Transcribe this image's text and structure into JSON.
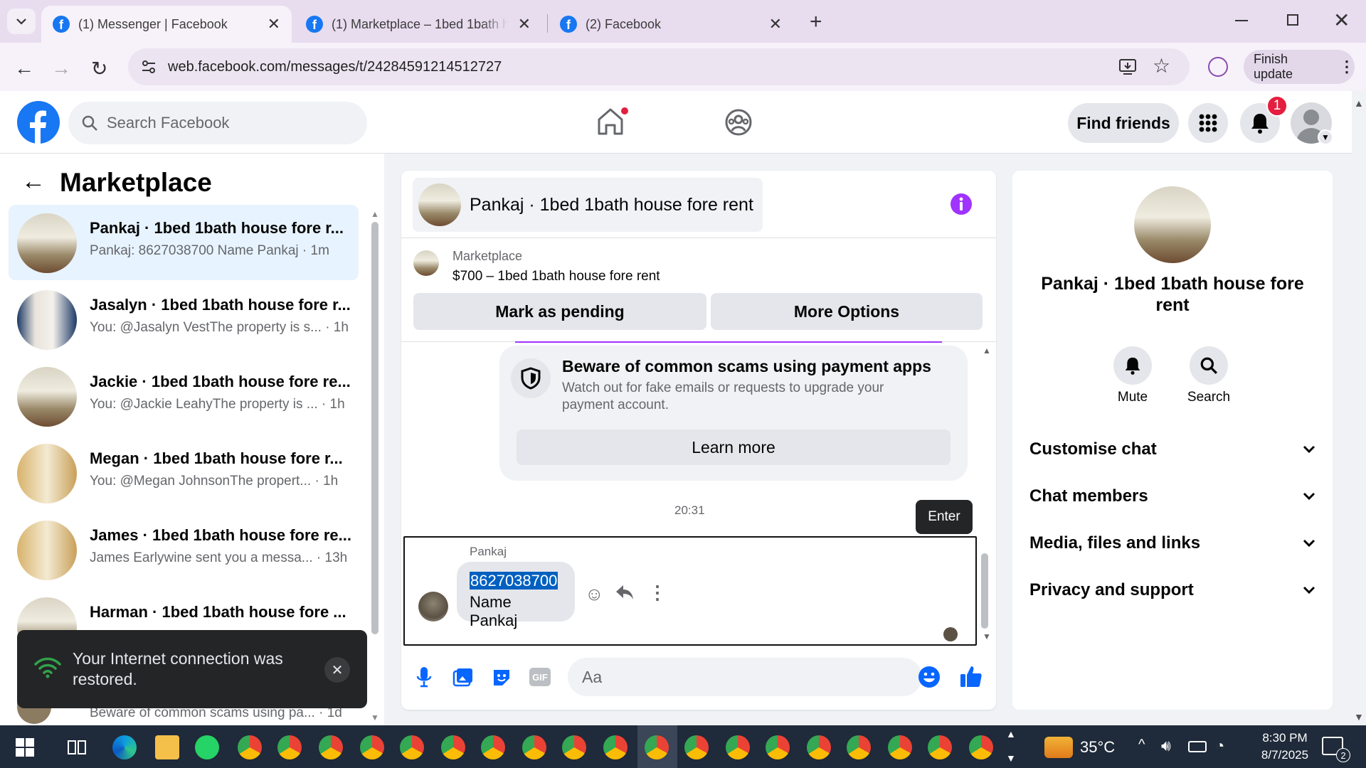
{
  "browser": {
    "tabs": [
      {
        "title": "(1) Messenger | Facebook",
        "active": true
      },
      {
        "title": "(1) Marketplace – 1bed 1bath h",
        "active": false
      },
      {
        "title": "(2) Facebook",
        "active": false
      }
    ],
    "url": "web.facebook.com/messages/t/24284591214512727",
    "finish_update": "Finish update"
  },
  "fb_header": {
    "search_placeholder": "Search Facebook",
    "find_friends": "Find friends",
    "notification_count": "1"
  },
  "left_panel": {
    "title": "Marketplace",
    "conversations": [
      {
        "name": "Pankaj · 1bed 1bath house fore r...",
        "preview": "Pankaj: 8627038700 Name Pankaj · 1m",
        "selected": true
      },
      {
        "name": "Jasalyn · 1bed 1bath house fore r...",
        "preview": "You: @Jasalyn VestThe property is s... · 1h"
      },
      {
        "name": "Jackie · 1bed 1bath house fore re...",
        "preview": "You: @Jackie LeahyThe property is ... · 1h"
      },
      {
        "name": "Megan · 1bed 1bath house fore r...",
        "preview": "You: @Megan JohnsonThe propert... · 1h"
      },
      {
        "name": "James · 1bed 1bath house fore re...",
        "preview": "James Earlywine sent you a messa... · 13h"
      },
      {
        "name": "Harman · 1bed 1bath house fore ...",
        "preview": ""
      }
    ],
    "hidden_preview": "Beware of common scams using pa... · 1d"
  },
  "toast": {
    "text": "Your Internet connection was restored."
  },
  "chat": {
    "title": "Pankaj · 1bed 1bath house fore rent",
    "listing_source": "Marketplace",
    "listing": "$700 – 1bed 1bath house fore rent",
    "mark_pending": "Mark as pending",
    "more_options": "More Options",
    "scam_title": "Beware of common scams using payment apps",
    "scam_body": "Watch out for fake emails or requests to upgrade your payment account.",
    "learn_more": "Learn more",
    "time": "20:31",
    "enter_tooltip": "Enter",
    "sender": "Pankaj",
    "message_line1": "8627038700",
    "message_line2": "Name Pankaj",
    "input_placeholder": "Aa"
  },
  "right_panel": {
    "name": "Pankaj · 1bed 1bath house fore rent",
    "mute": "Mute",
    "search": "Search",
    "sections": [
      "Customise chat",
      "Chat members",
      "Media, files and links",
      "Privacy and support"
    ]
  },
  "taskbar": {
    "temperature": "35°C",
    "time": "8:30 PM",
    "date": "8/7/2025",
    "notif_count": "2"
  },
  "colors": {
    "fb_blue": "#1877f2",
    "messenger_purple": "#a033ff",
    "selected_row": "#e7f3ff"
  }
}
